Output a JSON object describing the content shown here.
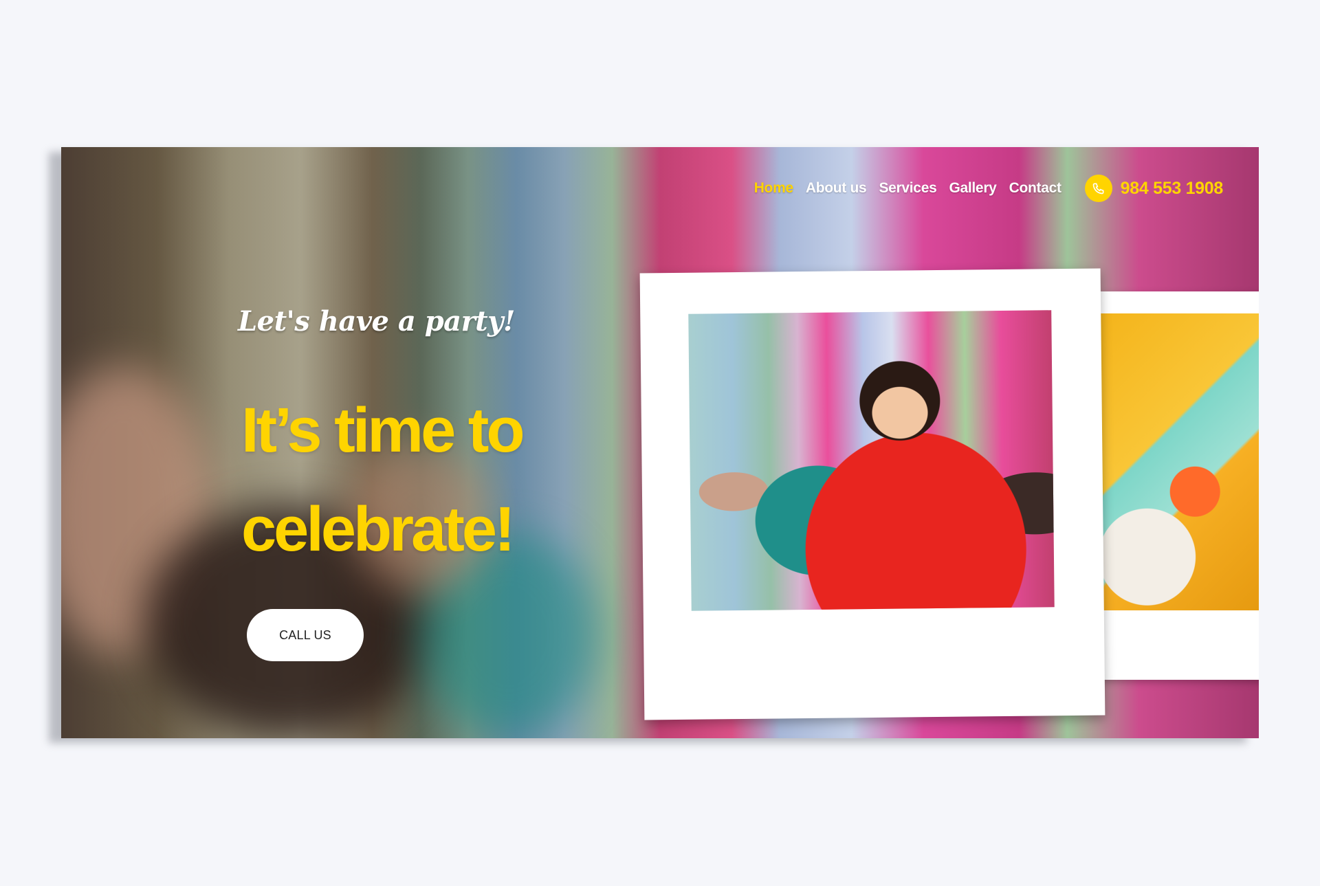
{
  "nav": {
    "items": [
      {
        "label": "Home",
        "active": true
      },
      {
        "label": "About us",
        "active": false
      },
      {
        "label": "Services",
        "active": false
      },
      {
        "label": "Gallery",
        "active": false
      },
      {
        "label": "Contact",
        "active": false
      }
    ],
    "phone": {
      "icon": "phone-icon",
      "number": "984 553 1908"
    }
  },
  "hero": {
    "tagline": "Let's have a party!",
    "headline_line1": "It’s time to",
    "headline_line2": "celebrate!",
    "cta_label": "CALL US"
  },
  "colors": {
    "accent": "#ffd400",
    "page_bg": "#f5f6fa",
    "text_light": "#ffffff"
  }
}
